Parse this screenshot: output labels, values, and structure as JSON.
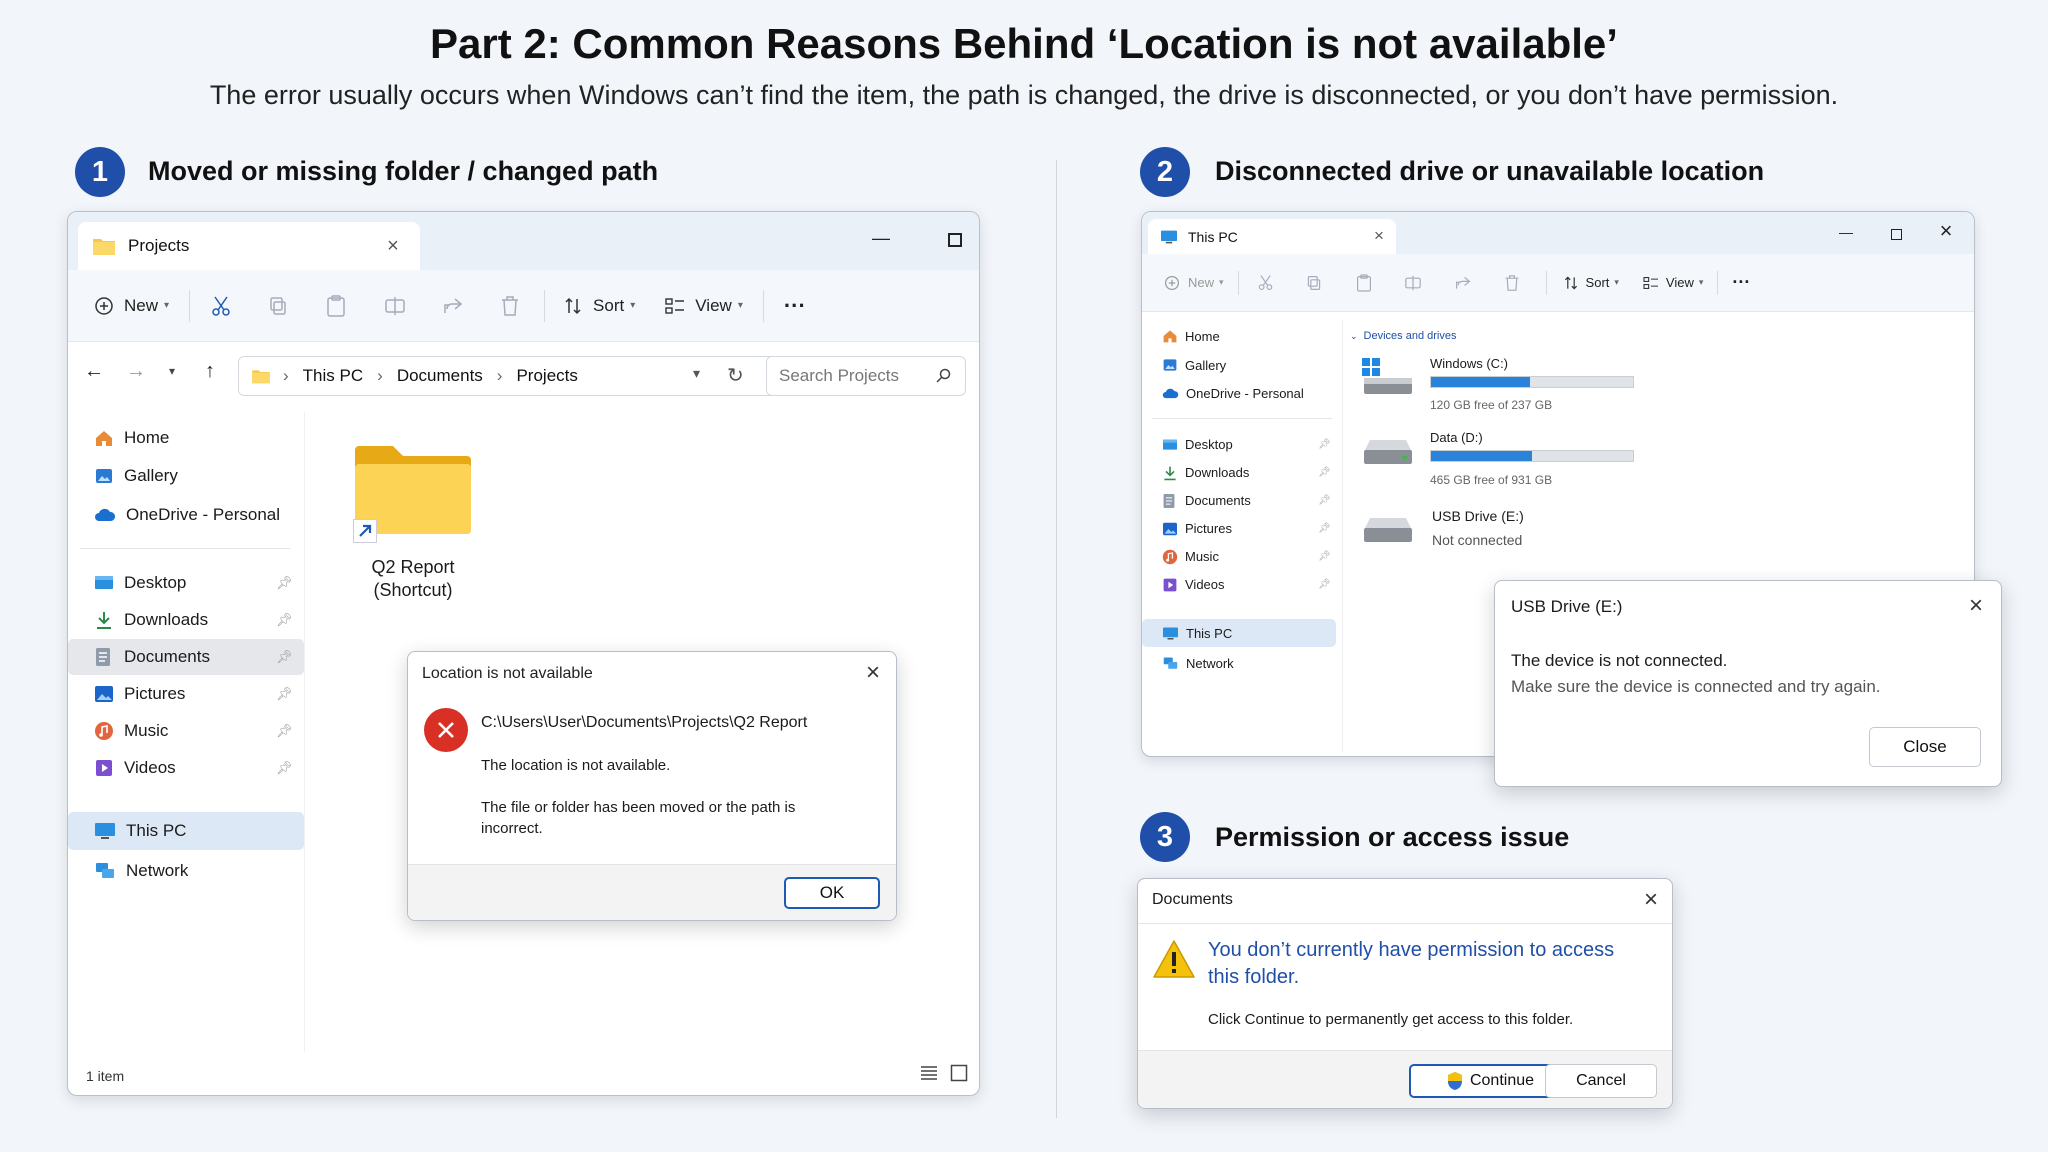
{
  "header": {
    "title": "Part 2: Common Reasons Behind ‘Location is not available’",
    "subtitle": "The error usually occurs when Windows can’t find the item, the path is changed, the drive is disconnected, or you don’t have permission."
  },
  "sections": [
    {
      "number": "1",
      "title": "Moved or missing folder / changed path"
    },
    {
      "number": "2",
      "title": "Disconnected drive or unavailable location"
    },
    {
      "number": "3",
      "title": "Permission or access issue"
    }
  ],
  "explorer1": {
    "tab_label": "Projects",
    "toolbar": {
      "new_label": "New",
      "sort_label": "Sort",
      "view_label": "View",
      "more_label": "···"
    },
    "breadcrumb": [
      "This PC",
      "Documents",
      "Projects"
    ],
    "search_placeholder": "Search Projects",
    "nav_top": [
      {
        "label": "Home",
        "icon": "home-icon"
      },
      {
        "label": "Gallery",
        "icon": "gallery-icon"
      },
      {
        "label": "OneDrive - Personal",
        "icon": "onedrive-icon"
      }
    ],
    "nav_quick": [
      {
        "label": "Desktop",
        "icon": "desktop-icon"
      },
      {
        "label": "Downloads",
        "icon": "download-icon"
      },
      {
        "label": "Documents",
        "icon": "documents-icon"
      },
      {
        "label": "Pictures",
        "icon": "pictures-icon"
      },
      {
        "label": "Music",
        "icon": "music-icon"
      },
      {
        "label": "Videos",
        "icon": "videos-icon"
      }
    ],
    "nav_bottom": [
      {
        "label": "This PC",
        "icon": "this-pc-icon"
      },
      {
        "label": "Network",
        "icon": "network-icon"
      }
    ],
    "item": {
      "name_line1": "Q2 Report",
      "name_line2": "(Shortcut)"
    },
    "status": "1 item",
    "colors": {
      "folder": "#f7c948",
      "selection": "#dde8f6",
      "accent": "#1e5ab4"
    }
  },
  "dialog1": {
    "title": "Location is not available",
    "path": "C:\\Users\\User\\Documents\\Projects\\Q2 Report",
    "line1": "The location is not available.",
    "line2a": "The file or folder has been moved or the path is",
    "line2b": "incorrect.",
    "ok_label": "OK",
    "error_color": "#d93025"
  },
  "explorer2": {
    "tab_label": "This PC",
    "toolbar": {
      "new_label": "New",
      "sort_label": "Sort",
      "view_label": "View",
      "more_label": "···"
    },
    "nav_top": [
      {
        "label": "Home",
        "icon": "home-icon"
      },
      {
        "label": "Gallery",
        "icon": "gallery-icon"
      },
      {
        "label": "OneDrive - Personal",
        "icon": "onedrive-icon"
      }
    ],
    "nav_quick": [
      {
        "label": "Desktop",
        "icon": "desktop-icon"
      },
      {
        "label": "Downloads",
        "icon": "download-icon"
      },
      {
        "label": "Documents",
        "icon": "documents-icon"
      },
      {
        "label": "Pictures",
        "icon": "pictures-icon"
      },
      {
        "label": "Music",
        "icon": "music-icon"
      },
      {
        "label": "Videos",
        "icon": "videos-icon"
      }
    ],
    "nav_bottom": [
      {
        "label": "This PC",
        "icon": "this-pc-icon"
      },
      {
        "label": "Network",
        "icon": "network-icon"
      }
    ],
    "group_label": "Devices and drives",
    "drives": [
      {
        "name": "Windows (C:)",
        "detail": "120 GB free of 237 GB",
        "used_fraction": 0.49,
        "icon": "windows-drive-icon"
      },
      {
        "name": "Data (D:)",
        "detail": "465 GB free of 931 GB",
        "used_fraction": 0.5,
        "icon": "hard-drive-icon"
      },
      {
        "name": "USB Drive (E:)",
        "detail": "Not connected",
        "icon": "usb-drive-icon"
      }
    ]
  },
  "dialog2": {
    "title": "USB Drive (E:)",
    "line1": "The device is not connected.",
    "line2": "Make sure the device is connected and try again.",
    "close_label": "Close"
  },
  "dialog3": {
    "title": "Documents",
    "message_line1": "You don’t currently have permission to access",
    "message_line2": "this folder.",
    "detail": "Click Continue to permanently get access to this folder.",
    "continue_label": "Continue",
    "cancel_label": "Cancel",
    "warning_color": "#f4c20d",
    "message_color": "#1f4fa8"
  }
}
